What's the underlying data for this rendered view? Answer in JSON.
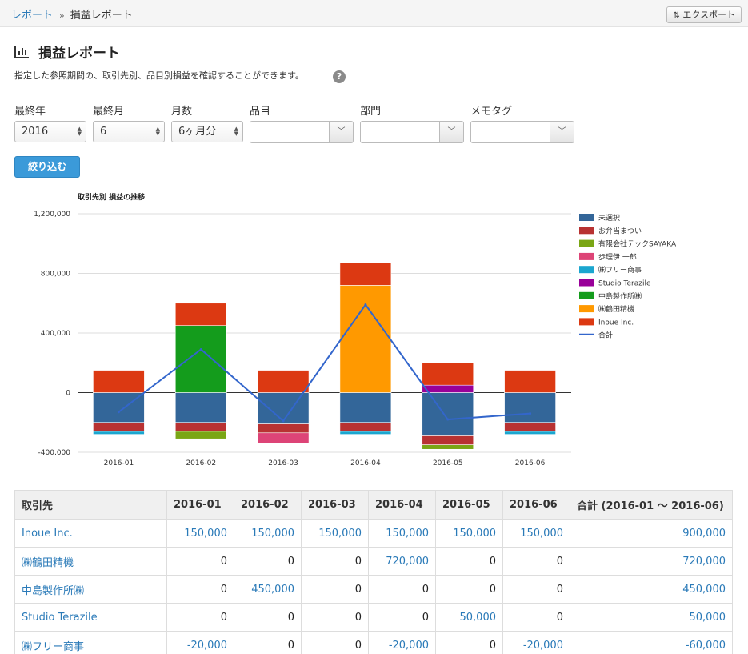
{
  "breadcrumb": {
    "parent": "レポート",
    "separator": "»",
    "current": "損益レポート"
  },
  "toolbar": {
    "export_label": "エクスポート",
    "export_icon": "export-arrows-icon"
  },
  "page": {
    "title": "損益レポート",
    "title_icon": "bar-chart-icon",
    "description": "指定した参照期間の、取引先別、品目別損益を確認することができます。",
    "help": "?"
  },
  "filters": {
    "year": {
      "label": "最終年",
      "value": "2016"
    },
    "month": {
      "label": "最終月",
      "value": "6"
    },
    "months": {
      "label": "月数",
      "value": "6ヶ月分"
    },
    "item": {
      "label": "品目",
      "value": ""
    },
    "department": {
      "label": "部門",
      "value": ""
    },
    "memo_tag": {
      "label": "メモタグ",
      "value": ""
    },
    "submit_label": "絞り込む"
  },
  "chart_data": {
    "type": "bar",
    "stacked": true,
    "title": "取引先別 損益の推移",
    "categories": [
      "2016-01",
      "2016-02",
      "2016-03",
      "2016-04",
      "2016-05",
      "2016-06"
    ],
    "yticks": [
      "1,200,000",
      "800,000",
      "400,000",
      "0",
      "-400,000"
    ],
    "ylim": [
      -400000,
      1200000
    ],
    "grid": true,
    "legend_position": "right",
    "series": [
      {
        "name": "未選択",
        "color": "#336699",
        "values": [
          -200000,
          -200000,
          -210000,
          -200000,
          -290000,
          -200000
        ]
      },
      {
        "name": "お弁当まつい",
        "color": "#b83232",
        "values": [
          -60000,
          -60000,
          -60000,
          -60000,
          -60000,
          -60000
        ]
      },
      {
        "name": "有限会社テックSAYAKA",
        "color": "#7aa615",
        "values": [
          0,
          -50000,
          0,
          0,
          -30000,
          0
        ]
      },
      {
        "name": "歩理伊 一郎",
        "color": "#dd4477",
        "values": [
          0,
          0,
          -70000,
          0,
          0,
          0
        ]
      },
      {
        "name": "㈱フリー商事",
        "color": "#1ba6cf",
        "values": [
          -20000,
          0,
          0,
          -20000,
          0,
          -20000
        ]
      },
      {
        "name": "Studio Terazile",
        "color": "#990099",
        "values": [
          0,
          0,
          0,
          0,
          50000,
          0
        ]
      },
      {
        "name": "中島製作所㈱",
        "color": "#149c1c",
        "values": [
          0,
          450000,
          0,
          0,
          0,
          0
        ]
      },
      {
        "name": "㈱鶴田精機",
        "color": "#ff9900",
        "values": [
          0,
          0,
          0,
          720000,
          0,
          0
        ]
      },
      {
        "name": "Inoue Inc.",
        "color": "#dc3912",
        "values": [
          150000,
          150000,
          150000,
          150000,
          150000,
          150000
        ]
      }
    ],
    "line": {
      "name": "合計",
      "color": "#3366cc",
      "values": [
        -130000,
        290000,
        -190000,
        590000,
        -180000,
        -140000
      ]
    }
  },
  "table": {
    "headers": [
      "取引先",
      "2016-01",
      "2016-02",
      "2016-03",
      "2016-04",
      "2016-05",
      "2016-06",
      "合計 (2016-01 〜 2016-06)"
    ],
    "rows": [
      [
        "Inoue Inc.",
        "150,000",
        "150,000",
        "150,000",
        "150,000",
        "150,000",
        "150,000",
        "900,000"
      ],
      [
        "㈱鶴田精機",
        "0",
        "0",
        "0",
        "720,000",
        "0",
        "0",
        "720,000"
      ],
      [
        "中島製作所㈱",
        "0",
        "450,000",
        "0",
        "0",
        "0",
        "0",
        "450,000"
      ],
      [
        "Studio Terazile",
        "0",
        "0",
        "0",
        "0",
        "50,000",
        "0",
        "50,000"
      ],
      [
        "㈱フリー商事",
        "-20,000",
        "0",
        "0",
        "-20,000",
        "0",
        "-20,000",
        "-60,000"
      ]
    ]
  }
}
